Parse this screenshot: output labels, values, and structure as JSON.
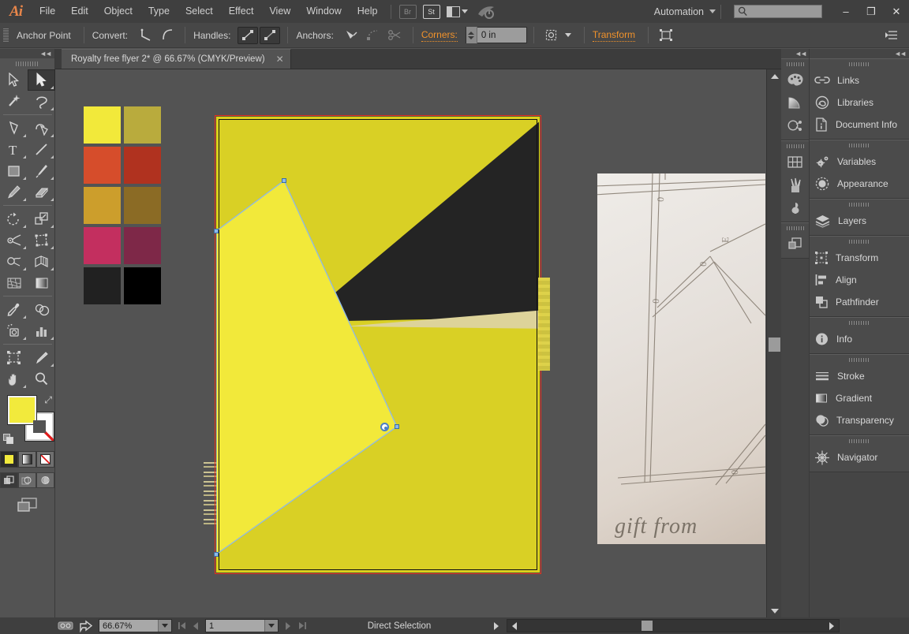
{
  "app": {
    "name": "Adobe Illustrator",
    "logo": "Ai"
  },
  "menubar": {
    "items": [
      "File",
      "Edit",
      "Object",
      "Type",
      "Select",
      "Effect",
      "View",
      "Window",
      "Help"
    ],
    "bridge_label": "Br",
    "stock_label": "St",
    "automation_label": "Automation",
    "search_placeholder": "",
    "search_value": ""
  },
  "window_controls": {
    "minimize": "–",
    "restore": "❐",
    "close": "✕"
  },
  "controlbar": {
    "tool_name": "Anchor Point",
    "convert_label": "Convert:",
    "handles_label": "Handles:",
    "anchors_label": "Anchors:",
    "corners_label": "Corners:",
    "corners_value": "0 in",
    "transform_label": "Transform"
  },
  "document": {
    "tab_title": "Royalty free flyer 2* @ 66.67% (CMYK/Preview)",
    "close_glyph": "✕"
  },
  "swatches": {
    "rows": [
      [
        "#f2e93a",
        "#b9ab3d"
      ],
      [
        "#d64d2b",
        "#b0321f"
      ],
      [
        "#cc9e2c",
        "#8b6b25"
      ],
      [
        "#c32f5f",
        "#7e2848"
      ],
      [
        "#212121",
        "#000000"
      ]
    ]
  },
  "artwork": {
    "board_color": "#d9d025",
    "black_shape_color": "#242424",
    "selected_shape_color": "#f2e93a",
    "tan_streak_color": "#ddd39a",
    "selection_outline": "#e8301a",
    "path_color": "#8db8e8"
  },
  "sketch": {
    "caption": "gift from"
  },
  "toolbar": {
    "tools": [
      "selection-tool",
      "direct-selection-tool",
      "magic-wand-tool",
      "lasso-tool",
      "pen-tool",
      "curvature-tool",
      "type-tool",
      "line-segment-tool",
      "rectangle-tool",
      "paintbrush-tool",
      "pencil-tool",
      "eraser-tool",
      "rotate-tool",
      "scale-tool",
      "width-tool",
      "free-transform-tool",
      "shape-builder-tool",
      "perspective-grid-tool",
      "mesh-tool",
      "gradient-tool",
      "eyedropper-tool",
      "blend-tool",
      "symbol-sprayer-tool",
      "column-graph-tool",
      "artboard-tool",
      "slice-tool",
      "hand-tool",
      "zoom-tool"
    ],
    "active_tool": "direct-selection-tool",
    "fill_color": "#f2e93a",
    "stroke_color": "none",
    "color_modes": [
      "color-swatch",
      "gradient-swatch",
      "none-swatch"
    ],
    "active_color_mode": "color-swatch",
    "draw_modes": [
      "draw-normal",
      "draw-behind",
      "draw-inside"
    ],
    "active_draw_mode": "draw-normal",
    "screen_mode": "screen-mode-toggle"
  },
  "rail": {
    "groups": [
      [
        "color-panel-icon",
        "color-guide-icon",
        "swatches-group-icon"
      ],
      [
        "symbols-panel-icon",
        "brushes-panel-icon",
        "graphic-styles-icon"
      ],
      [
        "artboards-panel-icon"
      ]
    ]
  },
  "right_panel": {
    "groups": [
      {
        "items": [
          {
            "label": "Links",
            "icon": "links-icon"
          },
          {
            "label": "Libraries",
            "icon": "libraries-icon"
          },
          {
            "label": "Document Info",
            "icon": "document-info-icon"
          }
        ]
      },
      {
        "items": [
          {
            "label": "Variables",
            "icon": "variables-icon"
          },
          {
            "label": "Appearance",
            "icon": "appearance-icon"
          }
        ]
      },
      {
        "items": [
          {
            "label": "Layers",
            "icon": "layers-icon"
          }
        ]
      },
      {
        "items": [
          {
            "label": "Transform",
            "icon": "transform-icon"
          },
          {
            "label": "Align",
            "icon": "align-icon"
          },
          {
            "label": "Pathfinder",
            "icon": "pathfinder-icon"
          }
        ]
      },
      {
        "items": [
          {
            "label": "Info",
            "icon": "info-icon"
          }
        ]
      },
      {
        "items": [
          {
            "label": "Stroke",
            "icon": "stroke-icon"
          },
          {
            "label": "Gradient",
            "icon": "gradient-icon"
          },
          {
            "label": "Transparency",
            "icon": "transparency-icon"
          }
        ]
      },
      {
        "items": [
          {
            "label": "Navigator",
            "icon": "navigator-icon"
          }
        ]
      }
    ]
  },
  "statusbar": {
    "zoom_value": "66.67%",
    "artboard_value": "1",
    "status_text": "Direct Selection"
  },
  "colors": {
    "chrome": "#535353",
    "chrome_dark": "#3f3f3f",
    "accent_orange": "#f0922b",
    "text": "#d2d2d2"
  }
}
